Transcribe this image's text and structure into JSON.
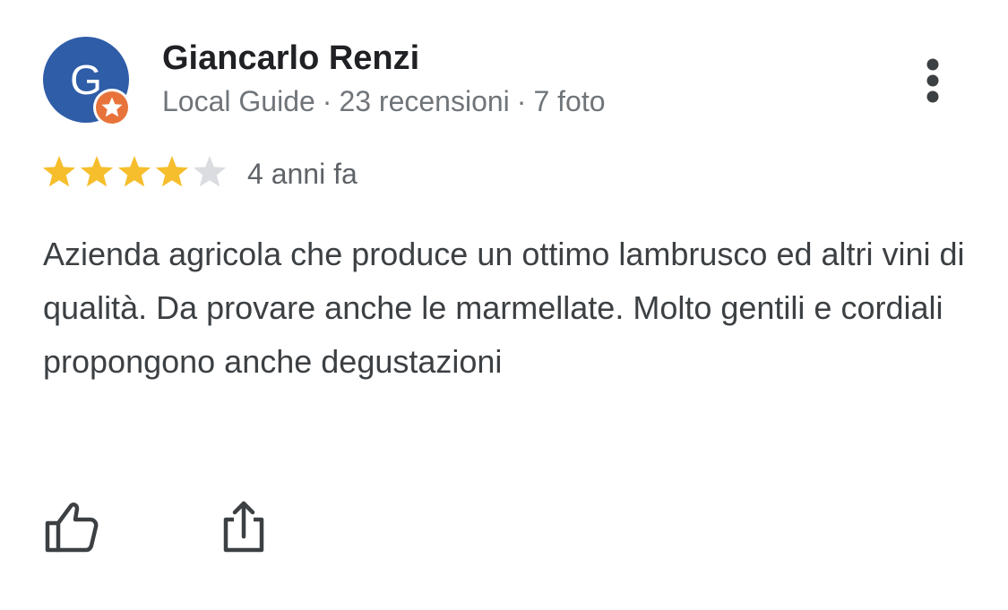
{
  "author": {
    "avatar_letter": "G",
    "name": "Giancarlo Renzi",
    "role": "Local Guide",
    "reviews_count": "23 recensioni",
    "photos_count": "7 foto",
    "separator": "·"
  },
  "review": {
    "rating": 4,
    "max_rating": 5,
    "time": "4 anni fa",
    "text": "Azienda agricola che produce un ottimo lambrusco ed altri vini di qualità. Da provare anche le marmellate. Molto gentili e cordiali propongono anche degustazioni"
  },
  "icons": {
    "more": "more-vert-icon",
    "like": "thumbs-up-icon",
    "share": "share-icon",
    "badge": "local-guide-star-icon",
    "star": "star-icon"
  },
  "colors": {
    "avatar_bg": "#2f5da8",
    "badge": "#e8733a",
    "star_filled": "#f6be2d",
    "star_empty": "#dadce0",
    "meta_text": "#70757a"
  }
}
